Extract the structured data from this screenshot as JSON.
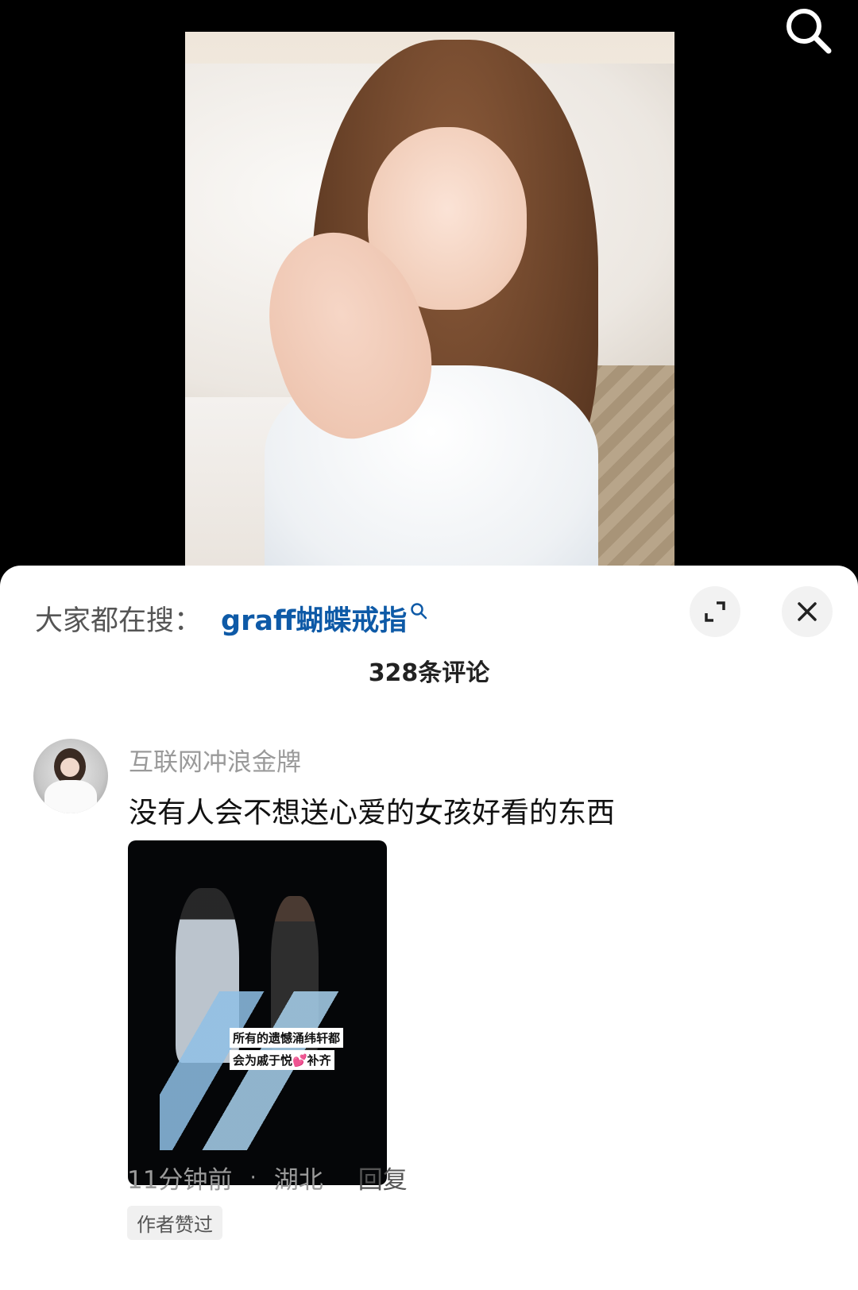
{
  "header": {
    "search_icon": "search-icon"
  },
  "sheet": {
    "suggest_prefix": "大家都在搜：",
    "suggest_term": "graff蝴蝶戒指",
    "comment_count": "328条评论"
  },
  "comments": [
    {
      "username": "互联网冲浪金牌",
      "text": "没有人会不想送心爱的女孩好看的东西",
      "attachment_caption_1": "所有的遗憾涌纬轩都",
      "attachment_caption_2": "会为戚于悦💕补齐",
      "time": "11分钟前",
      "dot": "·",
      "location": "湖北",
      "reply_label": "回复",
      "author_badge": "作者赞过"
    }
  ],
  "colors": {
    "accent": "#0e5aa7",
    "sheet_bg": "#ffffff",
    "muted": "#9a9a9a"
  }
}
